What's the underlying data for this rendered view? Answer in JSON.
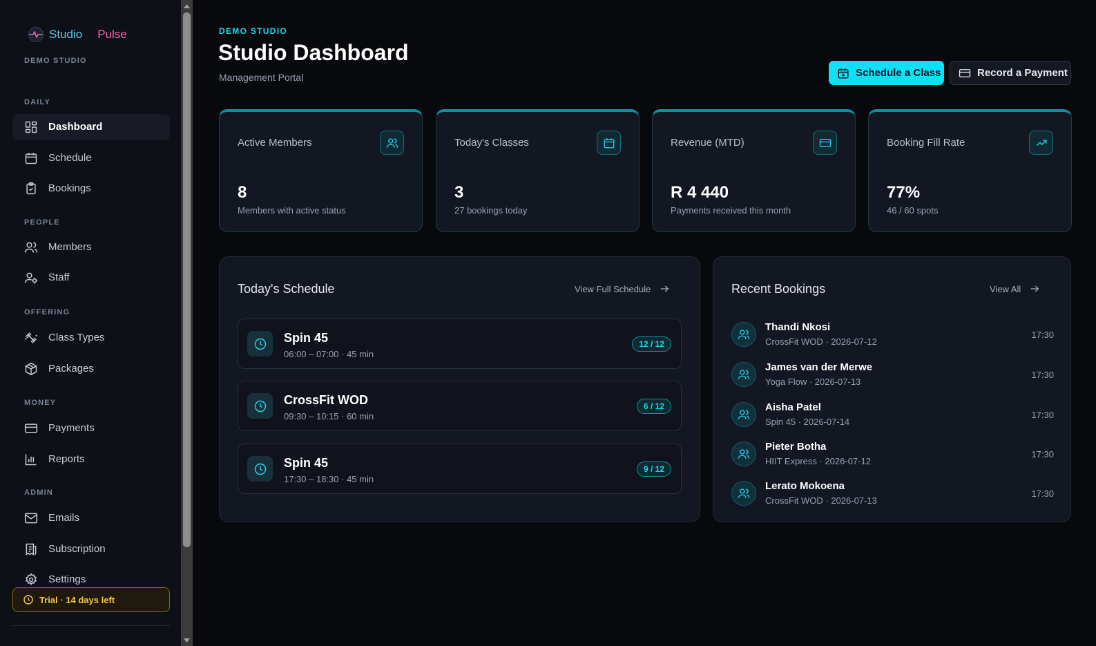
{
  "brand": {
    "word1": "Studio",
    "word2": "Pulse",
    "studio_name": "DEMO STUDIO"
  },
  "sidebar": {
    "sections": [
      {
        "label": "DAILY"
      },
      {
        "label": "PEOPLE"
      },
      {
        "label": "OFFERING"
      },
      {
        "label": "MONEY"
      },
      {
        "label": "ADMIN"
      }
    ],
    "items": [
      {
        "label": "Dashboard",
        "icon": "dashboard-icon",
        "active": true
      },
      {
        "label": "Schedule",
        "icon": "calendar-icon"
      },
      {
        "label": "Bookings",
        "icon": "clipboard-check-icon"
      },
      {
        "label": "Members",
        "icon": "users-icon"
      },
      {
        "label": "Staff",
        "icon": "user-cog-icon"
      },
      {
        "label": "Class Types",
        "icon": "dumbbell-icon"
      },
      {
        "label": "Packages",
        "icon": "package-icon"
      },
      {
        "label": "Payments",
        "icon": "credit-card-icon"
      },
      {
        "label": "Reports",
        "icon": "bar-chart-icon"
      },
      {
        "label": "Emails",
        "icon": "mail-icon"
      },
      {
        "label": "Subscription",
        "icon": "receipt-icon"
      },
      {
        "label": "Settings",
        "icon": "gear-icon"
      }
    ],
    "trial": "Trial · 14 days left"
  },
  "header": {
    "eyebrow": "DEMO STUDIO",
    "title": "Studio Dashboard",
    "subtitle": "Management Portal",
    "primary_button": "Schedule a Class",
    "secondary_button": "Record a Payment"
  },
  "stats": [
    {
      "label": "Active Members",
      "value": "8",
      "sub": "Members with active status",
      "icon": "users-icon"
    },
    {
      "label": "Today's Classes",
      "value": "3",
      "sub": "27 bookings today",
      "icon": "calendar-icon"
    },
    {
      "label": "Revenue (MTD)",
      "value": "R 4 440",
      "sub": "Payments received this month",
      "icon": "credit-card-icon"
    },
    {
      "label": "Booking Fill Rate",
      "value": "77%",
      "sub": "46 / 60 spots",
      "icon": "trending-up-icon"
    }
  ],
  "schedule": {
    "title": "Today's Schedule",
    "link": "View Full Schedule",
    "classes": [
      {
        "name": "Spin 45",
        "time": "06:00 – 07:00 · 45 min",
        "capacity": "12 / 12"
      },
      {
        "name": "CrossFit WOD",
        "time": "09:30 – 10:15 · 60 min",
        "capacity": "6 / 12"
      },
      {
        "name": "Spin 45",
        "time": "17:30 – 18:30 · 45 min",
        "capacity": "9 / 12"
      }
    ]
  },
  "bookings": {
    "title": "Recent Bookings",
    "link": "View All",
    "items": [
      {
        "name": "Thandi Nkosi",
        "meta": "CrossFit WOD · 2026-07-12",
        "time": "17:30"
      },
      {
        "name": "James van der Merwe",
        "meta": "Yoga Flow · 2026-07-13",
        "time": "17:30"
      },
      {
        "name": "Aisha Patel",
        "meta": "Spin 45 · 2026-07-14",
        "time": "17:30"
      },
      {
        "name": "Pieter Botha",
        "meta": "HIIT Express · 2026-07-12",
        "time": "17:30"
      },
      {
        "name": "Lerato Mokoena",
        "meta": "CrossFit WOD · 2026-07-13",
        "time": "17:30"
      }
    ]
  },
  "colors": {
    "accent": "#22d3ee",
    "primary_button": "#10e0f5",
    "trial": "#f5c642",
    "brand_blue": "#5bc6e3",
    "brand_pink": "#ef6aa6"
  }
}
